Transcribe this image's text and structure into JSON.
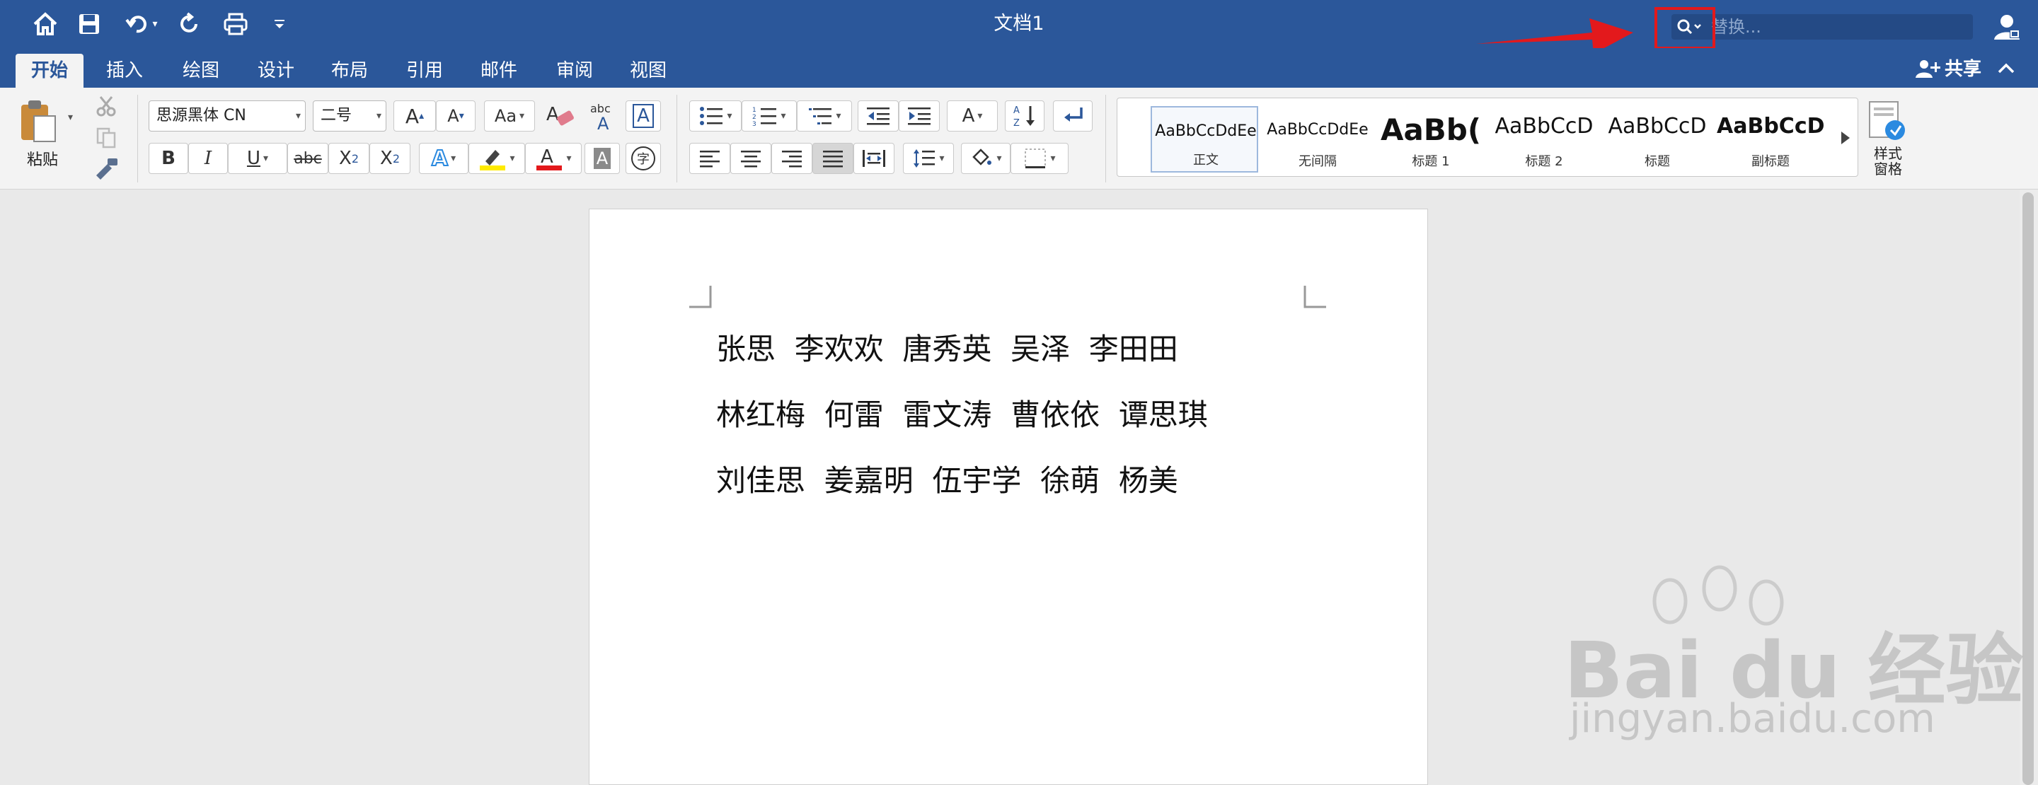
{
  "window": {
    "title": "文档1"
  },
  "quick_access": {
    "icons": [
      "home-icon",
      "save-icon",
      "undo-icon",
      "redo-icon",
      "print-icon",
      "customize-icon"
    ]
  },
  "search": {
    "placeholder": "替换..."
  },
  "tabs": [
    "开始",
    "插入",
    "绘图",
    "设计",
    "布局",
    "引用",
    "邮件",
    "审阅",
    "视图"
  ],
  "active_tab": "开始",
  "share": {
    "label": "共享"
  },
  "ribbon": {
    "paste_label": "粘贴",
    "font_name": "思源黑体 CN",
    "font_size": "二号",
    "styles": [
      {
        "sample": "AaBbCcDdEe",
        "name": "正文"
      },
      {
        "sample": "AaBbCcDdEe",
        "name": "无间隔"
      },
      {
        "sample": "AaBb(",
        "name": "标题 1"
      },
      {
        "sample": "AaBbCcD",
        "name": "标题 2"
      },
      {
        "sample": "AaBbCcD",
        "name": "标题"
      },
      {
        "sample": "AaBbCcD",
        "name": "副标题"
      }
    ],
    "styles_pane_label": "样式\n窗格"
  },
  "document": {
    "lines": [
      "张思  李欢欢  唐秀英  吴泽  李田田",
      "林红梅  何雷  雷文涛  曹依依  谭思琪",
      "刘佳思  姜嘉明  伍宇学  徐萌  杨美"
    ]
  },
  "watermark": {
    "brand": "Bai du 经验",
    "url": "jingyan.baidu.com"
  },
  "colors": {
    "titlebar": "#2b579a",
    "highlight": "#e3191c",
    "ribbon": "#f3f3f3"
  }
}
